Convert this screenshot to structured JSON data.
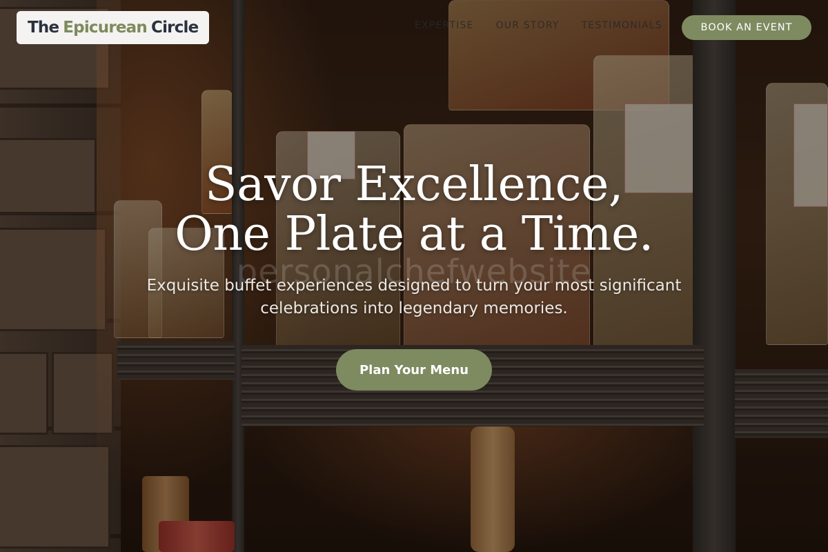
{
  "header": {
    "logo": {
      "part1": "The",
      "part2": "Epicurean",
      "part3": "Circle"
    },
    "nav": [
      {
        "label": "EXPERTISE"
      },
      {
        "label": "OUR STORY"
      },
      {
        "label": "TESTIMONIALS"
      }
    ],
    "book_button": "BOOK AN EVENT"
  },
  "hero": {
    "title": "Savor Excellence, One Plate at a Time.",
    "subtitle": "Exquisite buffet experiences designed to turn your most significant celebrations into legendary memories.",
    "cta": "Plan Your Menu",
    "watermark": "personalchefwebsite"
  },
  "colors": {
    "accent": "#7e8a60",
    "logo_text": "#2a3140",
    "logo_accent": "#7d8a5d"
  }
}
